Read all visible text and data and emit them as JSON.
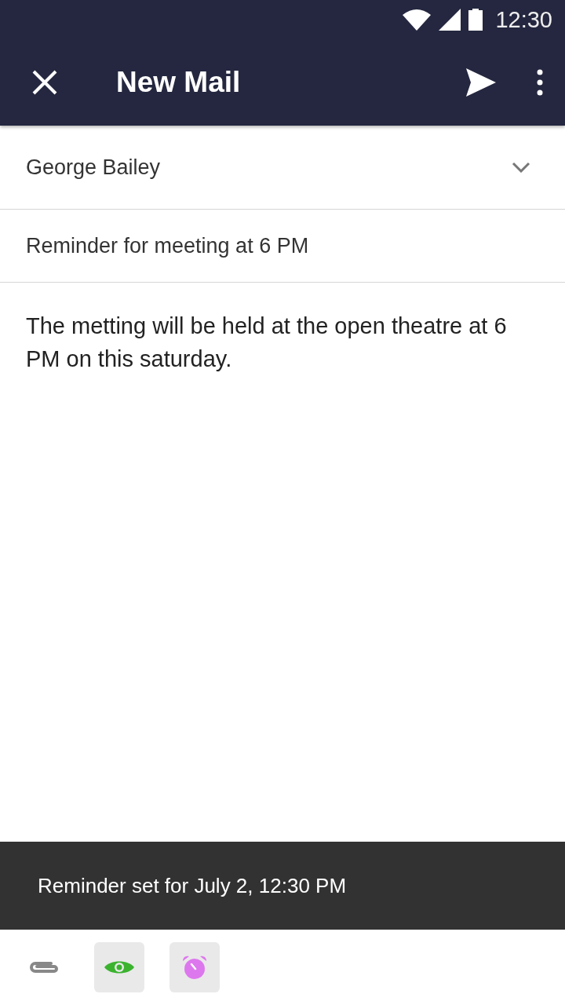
{
  "status_bar": {
    "time": "12:30"
  },
  "app_bar": {
    "title": "New Mail"
  },
  "recipient": {
    "value": "George Bailey"
  },
  "subject": {
    "value": "Reminder for meeting at 6 PM"
  },
  "body": {
    "value": "The metting will be held at the open theatre at 6 PM on this saturday."
  },
  "snackbar": {
    "message": "Reminder set for July 2, 12:30 PM"
  },
  "toolbar": [
    {
      "kind": "attach",
      "selected": false
    },
    {
      "kind": "eye",
      "selected": true
    },
    {
      "kind": "alarm",
      "selected": true
    }
  ]
}
